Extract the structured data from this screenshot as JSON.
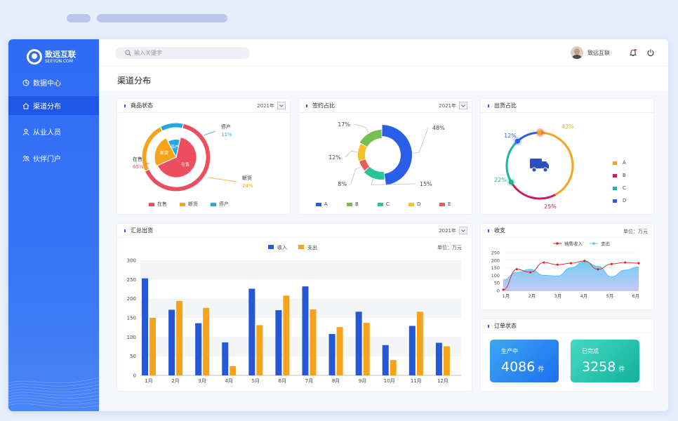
{
  "app": {
    "logo_cn": "致远互联",
    "logo_en": "SEEYON.COM"
  },
  "sidebar": {
    "items": [
      {
        "label": "数据中心",
        "icon": "dashboard-icon",
        "active": false
      },
      {
        "label": "渠道分布",
        "icon": "home-icon",
        "active": true
      },
      {
        "label": "从业人员",
        "icon": "user-icon",
        "active": false
      },
      {
        "label": "伙伴门户",
        "icon": "partners-icon",
        "active": false
      }
    ]
  },
  "header": {
    "search_placeholder": "输入关键字",
    "user_name": "致远互联"
  },
  "page": {
    "title": "渠道分布"
  },
  "cards": {
    "product_status": {
      "title": "商品状态",
      "year": "2021年"
    },
    "sign_share": {
      "title": "签约占比",
      "year": "2021年"
    },
    "shipment_share": {
      "title": "出货占比"
    },
    "summary": {
      "title": "汇总出货",
      "year": "2021年",
      "unit": "单位：万元"
    },
    "revenue": {
      "title": "收支",
      "unit": "单位：万元"
    },
    "orders": {
      "title": "订单状态"
    }
  },
  "orders": {
    "in_production": {
      "label": "生产中",
      "value": "4086",
      "unit": "件"
    },
    "completed": {
      "label": "已完成",
      "value": "3258",
      "unit": "件"
    }
  },
  "colors": {
    "primary": "#2f6bf5",
    "orange": "#f7a21b",
    "red": "#ec4d5f",
    "cyan": "#22a7e0",
    "income": "#2557d6"
  },
  "chart_data": [
    {
      "type": "pie",
      "categories": [
        "在售",
        "断货",
        "停产"
      ],
      "values": [
        65,
        24,
        11
      ],
      "inner_labels": [
        "在售",
        "断货",
        "停产"
      ],
      "pct_labels": [
        "65%",
        "24%",
        "11%"
      ],
      "colors": [
        "#ec4d5f",
        "#f7a21b",
        "#22a7e0"
      ]
    },
    {
      "type": "pie",
      "categories": [
        "A",
        "B",
        "C",
        "D",
        "E"
      ],
      "values": [
        48,
        15,
        8,
        12,
        17
      ],
      "pct_labels": [
        "48%",
        "15%",
        "8%",
        "12%",
        "17%"
      ],
      "colors": [
        "#2a5ee8",
        "#28c59a",
        "#ec5b5b",
        "#f7c025",
        "#72c04f"
      ],
      "legend": [
        "A",
        "B",
        "C",
        "D",
        "E"
      ],
      "legend_colors": [
        "#2a5ee8",
        "#72c04f",
        "#28c59a",
        "#f7c025",
        "#ec5b5b"
      ]
    },
    {
      "type": "pie",
      "categories": [
        "A",
        "B",
        "C",
        "D"
      ],
      "values": [
        43,
        25,
        22,
        12
      ],
      "pct_labels": [
        "43%",
        "25%",
        "22%",
        "12%"
      ],
      "colors": [
        "#f7a21b",
        "#d0185f",
        "#17b79c",
        "#2a5ee8"
      ],
      "legend": [
        "A",
        "B",
        "C",
        "D"
      ]
    },
    {
      "type": "bar",
      "categories": [
        "1月",
        "2月",
        "3月",
        "4月",
        "5月",
        "6月",
        "7月",
        "8月",
        "9月",
        "10月",
        "11月",
        "12月"
      ],
      "series": [
        {
          "name": "收入",
          "values": [
            253,
            171,
            136,
            86,
            226,
            170,
            232,
            108,
            166,
            79,
            129,
            85
          ],
          "color": "#2557d6"
        },
        {
          "name": "支出",
          "values": [
            150,
            194,
            176,
            24,
            131,
            208,
            172,
            126,
            137,
            40,
            166,
            76
          ],
          "color": "#f7a21b"
        }
      ],
      "ylim": [
        0,
        300
      ],
      "yticks": [
        "0",
        "50",
        "100",
        "150",
        "200",
        "250",
        "300"
      ]
    },
    {
      "type": "line",
      "categories": [
        "1月",
        "2月",
        "3月",
        "4月",
        "5月",
        "6月"
      ],
      "series": [
        {
          "name": "销售收入",
          "values": [
            5,
            140,
            120,
            185,
            170,
            180,
            195,
            140,
            175,
            185,
            180
          ],
          "color": "#e52222"
        },
        {
          "name": "支出",
          "values": [
            70,
            120,
            140,
            100,
            95,
            150,
            190,
            160,
            90,
            135,
            155
          ],
          "color": "#4fc8ef"
        }
      ],
      "ylim": [
        0,
        250
      ],
      "yticks": [
        "0",
        "50",
        "100",
        "150",
        "200",
        "250"
      ]
    }
  ]
}
